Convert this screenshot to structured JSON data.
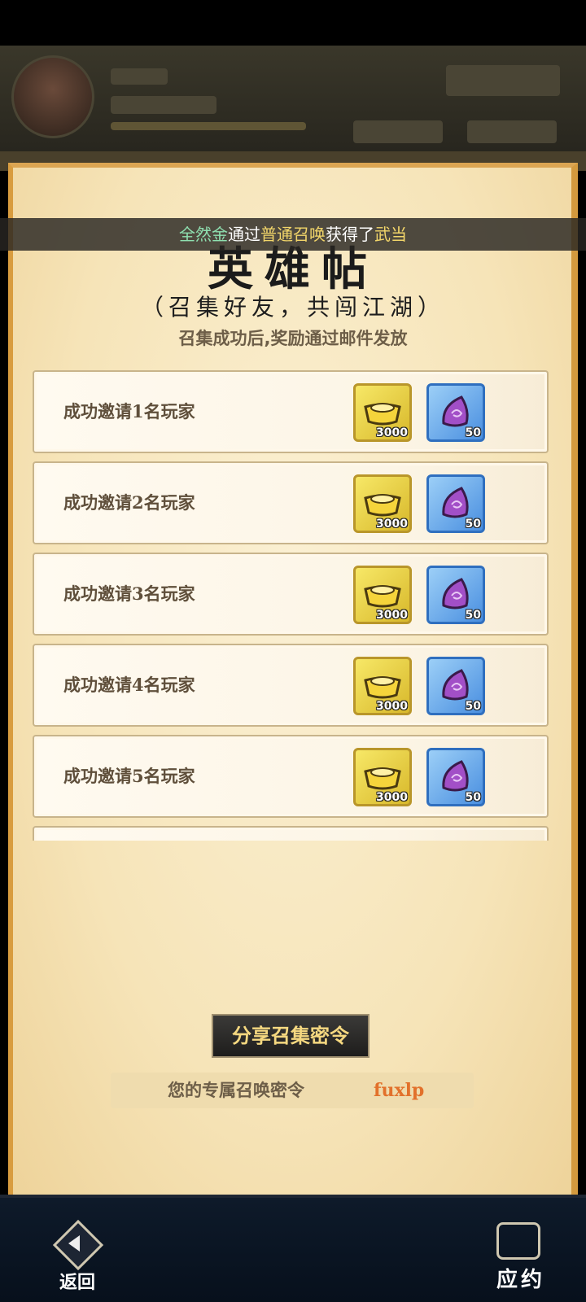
{
  "banner": {
    "player": "全然金",
    "middle1": "通过",
    "method": "普通召唤",
    "middle2": "获得了",
    "reward": "武当"
  },
  "title": "英雄帖",
  "subtitle": "（召集好友，共闯江湖）",
  "note": "召集成功后,奖励通过邮件发放",
  "rewards": [
    {
      "label": "成功邀请1名玩家",
      "gold_icon": "gold-ingot-icon",
      "gold_count": "3000",
      "gem_icon": "purple-jade-icon",
      "gem_count": "50"
    },
    {
      "label": "成功邀请2名玩家",
      "gold_icon": "gold-ingot-icon",
      "gold_count": "3000",
      "gem_icon": "purple-jade-icon",
      "gem_count": "50"
    },
    {
      "label": "成功邀请3名玩家",
      "gold_icon": "gold-ingot-icon",
      "gold_count": "3000",
      "gem_icon": "purple-jade-icon",
      "gem_count": "50"
    },
    {
      "label": "成功邀请4名玩家",
      "gold_icon": "gold-ingot-icon",
      "gold_count": "3000",
      "gem_icon": "purple-jade-icon",
      "gem_count": "50"
    },
    {
      "label": "成功邀请5名玩家",
      "gold_icon": "gold-ingot-icon",
      "gold_count": "3000",
      "gem_icon": "purple-jade-icon",
      "gem_count": "50"
    }
  ],
  "share_button": "分享召集密令",
  "code": {
    "label": "您的专属召唤密令",
    "value": "fuxlp"
  },
  "nav": {
    "back": "返回",
    "right": "应约"
  },
  "colors": {
    "parchment": "#f6e4b8",
    "code_value": "#e2712b",
    "banner_player": "#8fe0b0",
    "banner_reward": "#f3d66a"
  }
}
